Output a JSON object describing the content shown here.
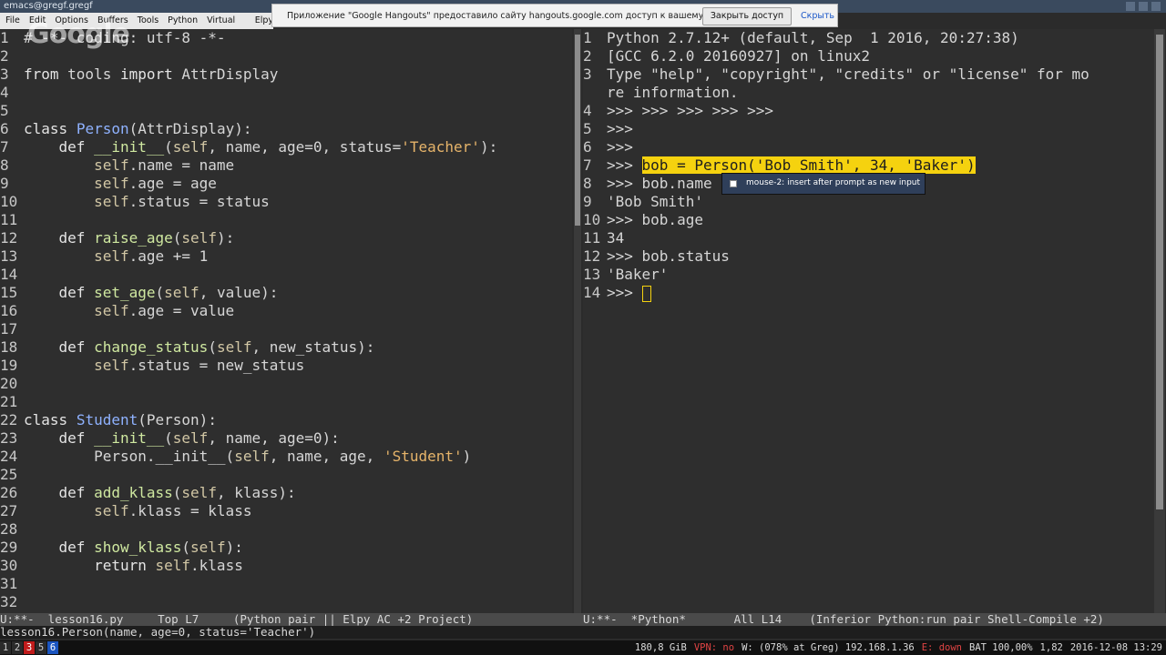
{
  "window": {
    "title": "emacs@gregf.gregf"
  },
  "menu": [
    "File",
    "Edit",
    "Options",
    "Buffers",
    "Tools",
    "Python",
    "Virtual Envs",
    "Elpy"
  ],
  "notification": {
    "message": "Приложение \"Google Hangouts\" предоставило сайту hangouts.google.com доступ к вашему экрану.",
    "stop_button": "Закрыть доступ",
    "hide_link": "Скрыть"
  },
  "overlay_logo": "Google",
  "left_pane": {
    "lines": [
      {
        "n": "1",
        "segs": [
          {
            "t": "# -*- coding: utf-8 -*-",
            "c": "txt"
          }
        ]
      },
      {
        "n": "2",
        "segs": []
      },
      {
        "n": "3",
        "segs": [
          {
            "t": "from",
            "c": "kw"
          },
          {
            "t": " tools ",
            "c": "txt"
          },
          {
            "t": "import",
            "c": "kw"
          },
          {
            "t": " AttrDisplay",
            "c": "txt"
          }
        ]
      },
      {
        "n": "4",
        "segs": []
      },
      {
        "n": "5",
        "segs": []
      },
      {
        "n": "6",
        "segs": [
          {
            "t": "class",
            "c": "kw"
          },
          {
            "t": " ",
            "c": "txt"
          },
          {
            "t": "Person",
            "c": "cls"
          },
          {
            "t": "(AttrDisplay):",
            "c": "txt"
          }
        ]
      },
      {
        "n": "7",
        "segs": [
          {
            "t": "    ",
            "c": "txt"
          },
          {
            "t": "def",
            "c": "kw"
          },
          {
            "t": " ",
            "c": "txt"
          },
          {
            "t": "__init__",
            "c": "fn"
          },
          {
            "t": "(",
            "c": "txt"
          },
          {
            "t": "self",
            "c": "slf"
          },
          {
            "t": ", name, age=0, status=",
            "c": "txt"
          },
          {
            "t": "'Teacher'",
            "c": "str"
          },
          {
            "t": "):",
            "c": "txt"
          }
        ]
      },
      {
        "n": "8",
        "segs": [
          {
            "t": "        ",
            "c": "txt"
          },
          {
            "t": "self",
            "c": "slf"
          },
          {
            "t": ".name = name",
            "c": "txt"
          }
        ]
      },
      {
        "n": "9",
        "segs": [
          {
            "t": "        ",
            "c": "txt"
          },
          {
            "t": "self",
            "c": "slf"
          },
          {
            "t": ".age = age",
            "c": "txt"
          }
        ]
      },
      {
        "n": "10",
        "segs": [
          {
            "t": "        ",
            "c": "txt"
          },
          {
            "t": "self",
            "c": "slf"
          },
          {
            "t": ".status = status",
            "c": "txt"
          }
        ]
      },
      {
        "n": "11",
        "segs": []
      },
      {
        "n": "12",
        "segs": [
          {
            "t": "    ",
            "c": "txt"
          },
          {
            "t": "def",
            "c": "kw"
          },
          {
            "t": " ",
            "c": "txt"
          },
          {
            "t": "raise_age",
            "c": "fn"
          },
          {
            "t": "(",
            "c": "txt"
          },
          {
            "t": "self",
            "c": "slf"
          },
          {
            "t": "):",
            "c": "txt"
          }
        ]
      },
      {
        "n": "13",
        "segs": [
          {
            "t": "        ",
            "c": "txt"
          },
          {
            "t": "self",
            "c": "slf"
          },
          {
            "t": ".age += 1",
            "c": "txt"
          }
        ]
      },
      {
        "n": "14",
        "segs": []
      },
      {
        "n": "15",
        "segs": [
          {
            "t": "    ",
            "c": "txt"
          },
          {
            "t": "def",
            "c": "kw"
          },
          {
            "t": " ",
            "c": "txt"
          },
          {
            "t": "set_age",
            "c": "fn"
          },
          {
            "t": "(",
            "c": "txt"
          },
          {
            "t": "self",
            "c": "slf"
          },
          {
            "t": ", value):",
            "c": "txt"
          }
        ]
      },
      {
        "n": "16",
        "segs": [
          {
            "t": "        ",
            "c": "txt"
          },
          {
            "t": "self",
            "c": "slf"
          },
          {
            "t": ".age = value",
            "c": "txt"
          }
        ]
      },
      {
        "n": "17",
        "segs": []
      },
      {
        "n": "18",
        "segs": [
          {
            "t": "    ",
            "c": "txt"
          },
          {
            "t": "def",
            "c": "kw"
          },
          {
            "t": " ",
            "c": "txt"
          },
          {
            "t": "change_status",
            "c": "fn"
          },
          {
            "t": "(",
            "c": "txt"
          },
          {
            "t": "self",
            "c": "slf"
          },
          {
            "t": ", new_status):",
            "c": "txt"
          }
        ]
      },
      {
        "n": "19",
        "segs": [
          {
            "t": "        ",
            "c": "txt"
          },
          {
            "t": "self",
            "c": "slf"
          },
          {
            "t": ".status = new_status",
            "c": "txt"
          }
        ]
      },
      {
        "n": "20",
        "segs": []
      },
      {
        "n": "21",
        "segs": []
      },
      {
        "n": "22",
        "segs": [
          {
            "t": "class",
            "c": "kw"
          },
          {
            "t": " ",
            "c": "txt"
          },
          {
            "t": "Student",
            "c": "cls"
          },
          {
            "t": "(Person):",
            "c": "txt"
          }
        ]
      },
      {
        "n": "23",
        "segs": [
          {
            "t": "    ",
            "c": "txt"
          },
          {
            "t": "def",
            "c": "kw"
          },
          {
            "t": " ",
            "c": "txt"
          },
          {
            "t": "__init__",
            "c": "fn"
          },
          {
            "t": "(",
            "c": "txt"
          },
          {
            "t": "self",
            "c": "slf"
          },
          {
            "t": ", name, age=0):",
            "c": "txt"
          }
        ]
      },
      {
        "n": "24",
        "segs": [
          {
            "t": "        Person.__init__(",
            "c": "txt"
          },
          {
            "t": "self",
            "c": "slf"
          },
          {
            "t": ", name, age, ",
            "c": "txt"
          },
          {
            "t": "'Student'",
            "c": "str"
          },
          {
            "t": ")",
            "c": "txt"
          }
        ]
      },
      {
        "n": "25",
        "segs": []
      },
      {
        "n": "26",
        "segs": [
          {
            "t": "    ",
            "c": "txt"
          },
          {
            "t": "def",
            "c": "kw"
          },
          {
            "t": " ",
            "c": "txt"
          },
          {
            "t": "add_klass",
            "c": "fn"
          },
          {
            "t": "(",
            "c": "txt"
          },
          {
            "t": "self",
            "c": "slf"
          },
          {
            "t": ", klass):",
            "c": "txt"
          }
        ]
      },
      {
        "n": "27",
        "segs": [
          {
            "t": "        ",
            "c": "txt"
          },
          {
            "t": "self",
            "c": "slf"
          },
          {
            "t": ".klass = klass",
            "c": "txt"
          }
        ]
      },
      {
        "n": "28",
        "segs": []
      },
      {
        "n": "29",
        "segs": [
          {
            "t": "    ",
            "c": "txt"
          },
          {
            "t": "def",
            "c": "kw"
          },
          {
            "t": " ",
            "c": "txt"
          },
          {
            "t": "show_klass",
            "c": "fn"
          },
          {
            "t": "(",
            "c": "txt"
          },
          {
            "t": "self",
            "c": "slf"
          },
          {
            "t": "):",
            "c": "txt"
          }
        ]
      },
      {
        "n": "30",
        "segs": [
          {
            "t": "        ",
            "c": "txt"
          },
          {
            "t": "return",
            "c": "kw"
          },
          {
            "t": " ",
            "c": "txt"
          },
          {
            "t": "self",
            "c": "slf"
          },
          {
            "t": ".klass",
            "c": "txt"
          }
        ]
      },
      {
        "n": "31",
        "segs": []
      },
      {
        "n": "32",
        "segs": []
      }
    ]
  },
  "right_pane": {
    "lines": [
      {
        "n": "1",
        "text": "Python 2.7.12+ (default, Sep  1 2016, 20:27:38)"
      },
      {
        "n": "2",
        "text": "[GCC 6.2.0 20160927] on linux2"
      },
      {
        "n": "3",
        "text": "Type \"help\", \"copyright\", \"credits\" or \"license\" for mo"
      },
      {
        "n": "",
        "text": "re information."
      },
      {
        "n": "4",
        "text": ">>> >>> >>> >>> >>>"
      },
      {
        "n": "5",
        "text": ">>>"
      },
      {
        "n": "6",
        "text": ">>>"
      },
      {
        "n": "7",
        "text": ">>> ",
        "highlight": "bob = Person('Bob Smith', 34, 'Baker')"
      },
      {
        "n": "8",
        "text": ">>> bob.name"
      },
      {
        "n": "9",
        "text": "'Bob Smith'"
      },
      {
        "n": "10",
        "text": ">>> bob.age"
      },
      {
        "n": "11",
        "text": "34"
      },
      {
        "n": "12",
        "text": ">>> bob.status"
      },
      {
        "n": "13",
        "text": "'Baker'"
      },
      {
        "n": "14",
        "text": ">>> ",
        "cursor": true
      }
    ]
  },
  "tooltip": {
    "text": "mouse-2: insert after prompt as new input"
  },
  "modeline_left": "U:**-  lesson16.py     Top L7     (Python pair || Elpy AC +2 Project)",
  "modeline_right": "U:**-  *Python*       All L14    (Inferior Python:run pair Shell-Compile +2)",
  "minibuffer": "lesson16.Person(name, age=0, status='Teacher')",
  "statusbar": {
    "workspaces": [
      "1",
      "2",
      "3",
      "5",
      "6"
    ],
    "items": [
      "180,8 GiB",
      "VPN: no",
      "W: (078% at Greg) 192.168.1.36",
      "E: down",
      "BAT 100,00%",
      "1,82",
      "2016-12-08 13:29"
    ]
  }
}
